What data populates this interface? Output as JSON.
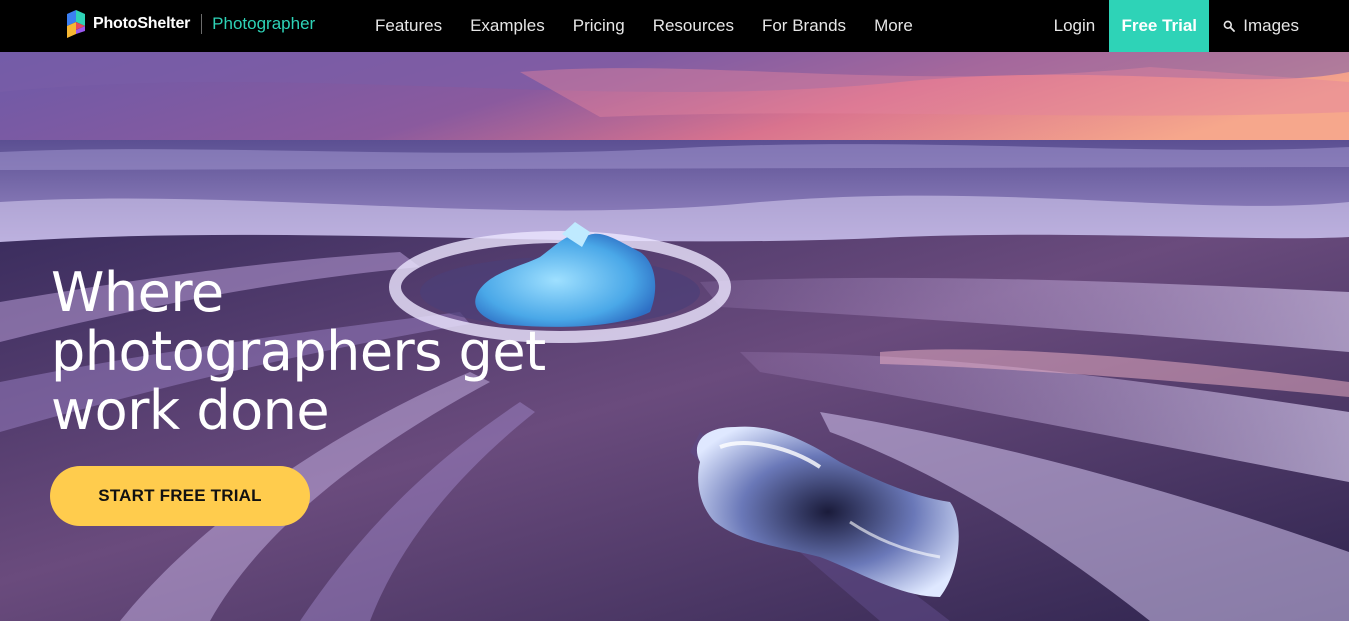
{
  "brand": {
    "name": "PhotoShelter",
    "product": "Photographer",
    "logo_icon": "photoshelter-logo-icon"
  },
  "nav": {
    "links": [
      "Features",
      "Examples",
      "Pricing",
      "Resources",
      "For Brands",
      "More"
    ],
    "login_label": "Login",
    "trial_label": "Free Trial",
    "images_label": "Images",
    "search_icon": "search-icon"
  },
  "hero": {
    "title": "Where photographers get work done",
    "cta_label": "START FREE TRIAL",
    "background": "beach-ice-long-exposure-photo"
  },
  "colors": {
    "nav_bg": "#000000",
    "accent_teal": "#2ed3b7",
    "cta_yellow": "#ffcc4d",
    "text_light": "#e6e6e6"
  }
}
